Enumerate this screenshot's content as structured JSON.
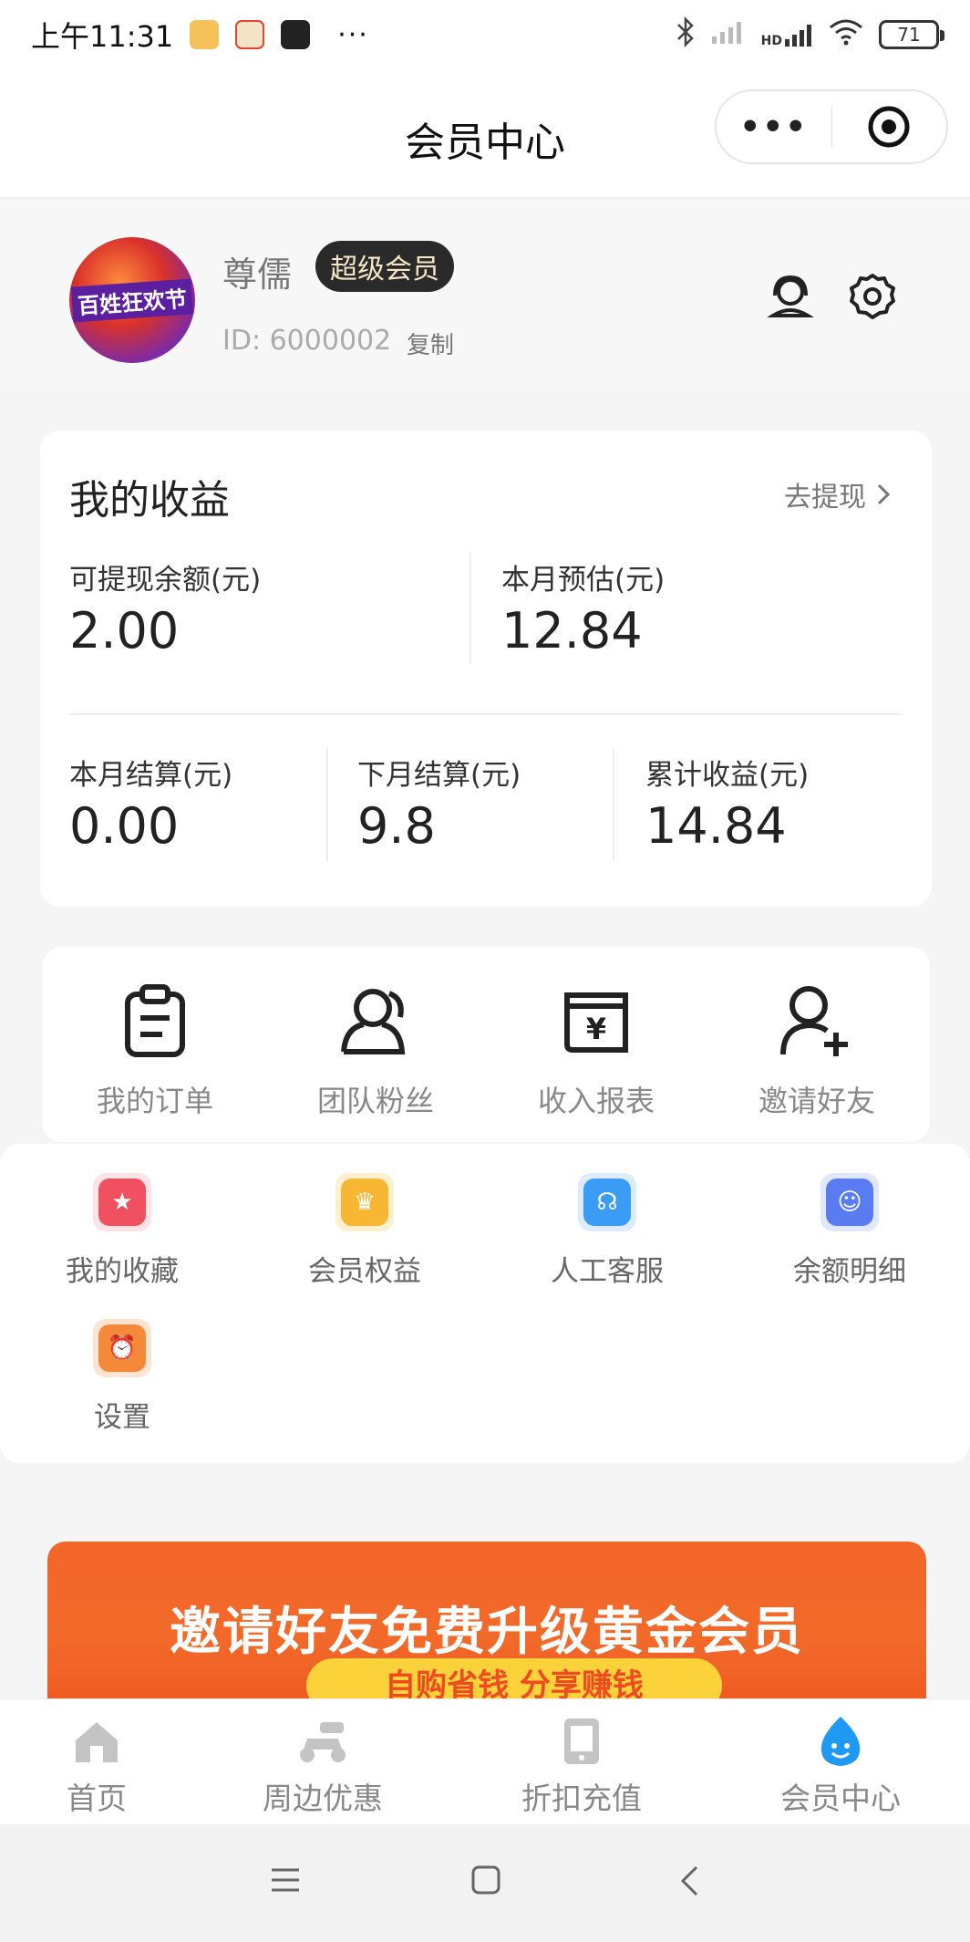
{
  "status_bar": {
    "time": "上午11:31",
    "dots": "···",
    "network": "HD",
    "battery": "71"
  },
  "nav": {
    "title": "会员中心",
    "more": "•••"
  },
  "profile": {
    "name": "尊儒",
    "badge": "超级会员",
    "id_text": "ID: 6000002",
    "copy_label": "复制",
    "avatar_text": "百姓狂欢节"
  },
  "earnings": {
    "title": "我的收益",
    "withdraw_label": "去提现",
    "withdrawable": {
      "label": "可提现余额(元)",
      "value": "2.00"
    },
    "month_estimate": {
      "label": "本月预估(元)",
      "value": "12.84"
    },
    "month_settled": {
      "label": "本月结算(元)",
      "value": "0.00"
    },
    "next_month_settled": {
      "label": "下月结算(元)",
      "value": "9.8"
    },
    "total": {
      "label": "累计收益(元)",
      "value": "14.84"
    }
  },
  "quick_menu": [
    {
      "label": "我的订单",
      "icon": "clipboard-icon"
    },
    {
      "label": "团队粉丝",
      "icon": "team-icon"
    },
    {
      "label": "收入报表",
      "icon": "yen-report-icon"
    },
    {
      "label": "邀请好友",
      "icon": "add-user-icon"
    }
  ],
  "services": [
    {
      "label": "我的收藏",
      "icon": "star-icon",
      "color": "#f0505f"
    },
    {
      "label": "会员权益",
      "icon": "crown-icon",
      "color": "#f7b733"
    },
    {
      "label": "人工客服",
      "icon": "headset-icon",
      "color": "#3b9cf5"
    },
    {
      "label": "余额明细",
      "icon": "wallet-icon",
      "color": "#5a7cf2"
    },
    {
      "label": "设置",
      "icon": "alarm-icon",
      "color": "#f4893a"
    }
  ],
  "banner": {
    "title": "邀请好友免费升级黄金会员",
    "subtitle": "自购省钱 分享赚钱"
  },
  "tabs": [
    {
      "label": "首页",
      "icon": "home-icon"
    },
    {
      "label": "周边优惠",
      "icon": "scooter-icon"
    },
    {
      "label": "折扣充值",
      "icon": "tablet-icon"
    },
    {
      "label": "会员中心",
      "icon": "member-icon",
      "active": true
    }
  ],
  "colors": {
    "accent_blue": "#1e9af5",
    "banner_orange": "#f26a2a",
    "badge_dark": "#2a2a2a"
  }
}
